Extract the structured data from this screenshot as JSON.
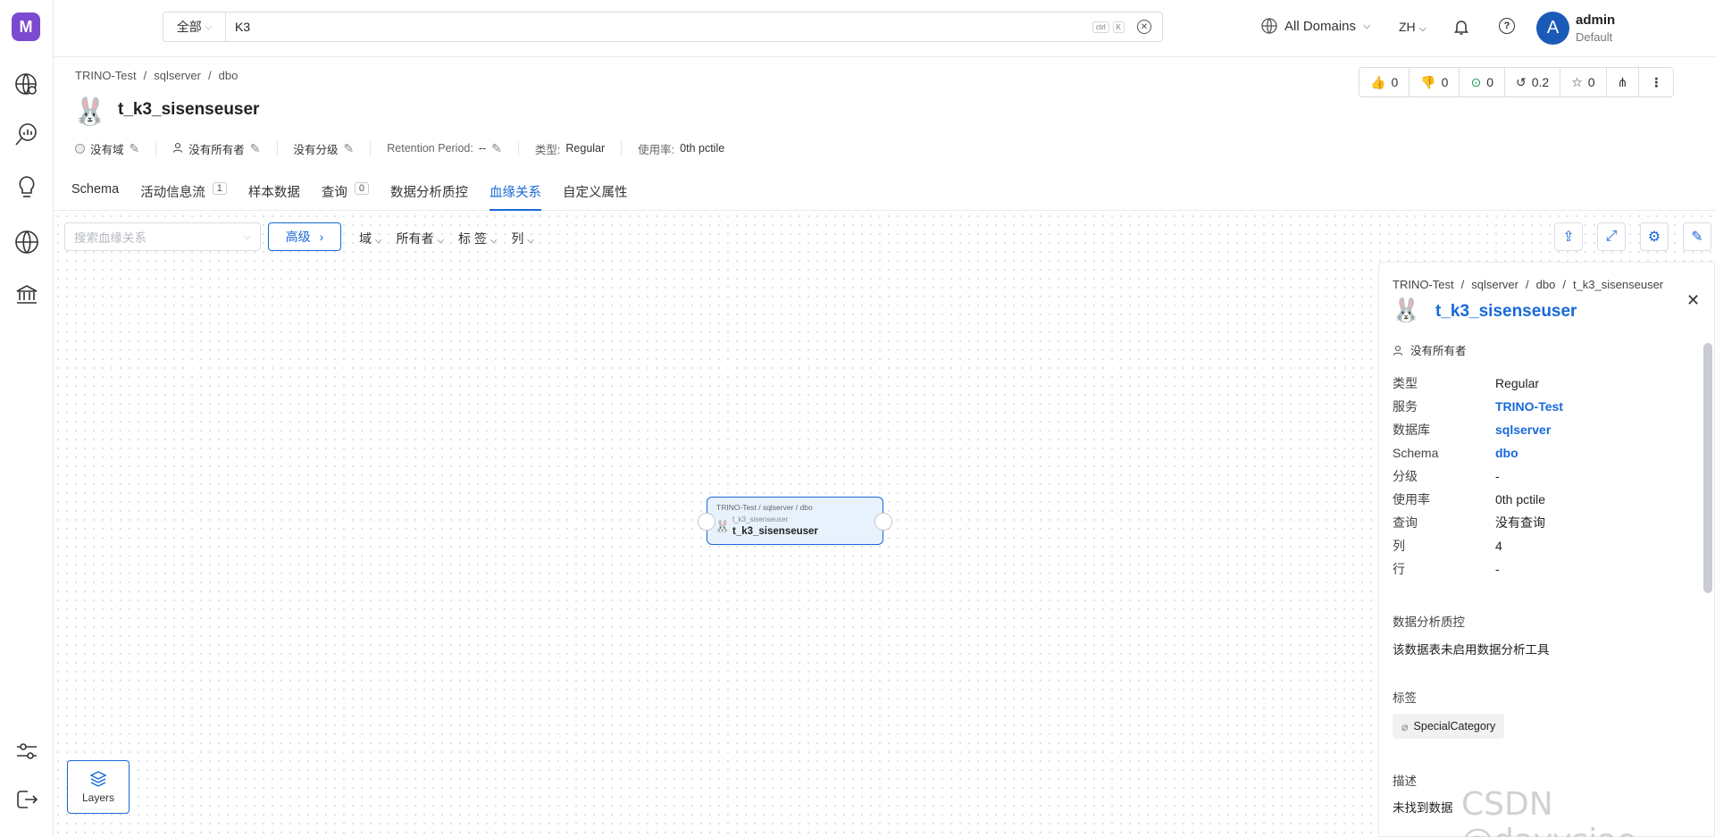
{
  "topbar": {
    "search_scope": "全部",
    "search_value": "K3",
    "kbd_ctrl": "ctrl",
    "kbd_k": "K",
    "domains_label": "All Domains",
    "language": "ZH",
    "user_initial": "A",
    "user_name": "admin",
    "user_role": "Default"
  },
  "breadcrumb": [
    "TRINO-Test",
    "sqlserver",
    "dbo"
  ],
  "entity": {
    "title": "t_k3_sisenseuser",
    "domain": "没有域",
    "owner": "没有所有者",
    "tier": "没有分级",
    "retention_label": "Retention Period:",
    "retention_value": "--",
    "type_label": "类型:",
    "type_value": "Regular",
    "usage_label": "使用率:",
    "usage_value": "0th pctile"
  },
  "stats": {
    "likes": "0",
    "dislikes": "0",
    "followers": "0",
    "version": "0.2",
    "stars": "0"
  },
  "tabs": [
    {
      "label": "Schema",
      "count": ""
    },
    {
      "label": "活动信息流",
      "count": "1"
    },
    {
      "label": "样本数据",
      "count": ""
    },
    {
      "label": "查询",
      "count": "0"
    },
    {
      "label": "数据分析质控",
      "count": ""
    },
    {
      "label": "血缘关系",
      "count": ""
    },
    {
      "label": "自定义属性",
      "count": ""
    }
  ],
  "lineage": {
    "search_placeholder": "搜索血缘关系",
    "advanced_label": "高级",
    "filters": [
      "域",
      "所有者",
      "标 签",
      "列"
    ],
    "node": {
      "path": "TRINO-Test / sqlserver / dbo",
      "sub": "t_k3_sisenseuser",
      "name": "t_k3_sisenseuser"
    },
    "layers_label": "Layers"
  },
  "panel": {
    "breadcrumb": [
      "TRINO-Test",
      "sqlserver",
      "dbo",
      "t_k3_sisenseuser"
    ],
    "title": "t_k3_sisenseuser",
    "owner": "没有所有者",
    "props": [
      {
        "key": "类型",
        "value": "Regular",
        "link": false
      },
      {
        "key": "服务",
        "value": "TRINO-Test",
        "link": true
      },
      {
        "key": "数据库",
        "value": "sqlserver",
        "link": true
      },
      {
        "key": "Schema",
        "value": "dbo",
        "link": true
      },
      {
        "key": "分级",
        "value": "-",
        "link": false
      },
      {
        "key": "使用率",
        "value": "0th pctile",
        "link": false
      },
      {
        "key": "查询",
        "value": "没有查询",
        "link": false
      },
      {
        "key": "列",
        "value": "4",
        "link": false
      },
      {
        "key": "行",
        "value": "-",
        "link": false
      }
    ],
    "profiler_label": "数据分析质控",
    "profiler_text": "该数据表未启用数据分析工具",
    "tags_label": "标签",
    "tag": "SpecialCategory",
    "desc_label": "描述",
    "desc_text": "未找到数据"
  },
  "watermark": "CSDN @davysiao",
  "colors": {
    "accent": "#1868d9",
    "brand": "#7b4ad0",
    "node_bg": "#e8f2fd"
  }
}
